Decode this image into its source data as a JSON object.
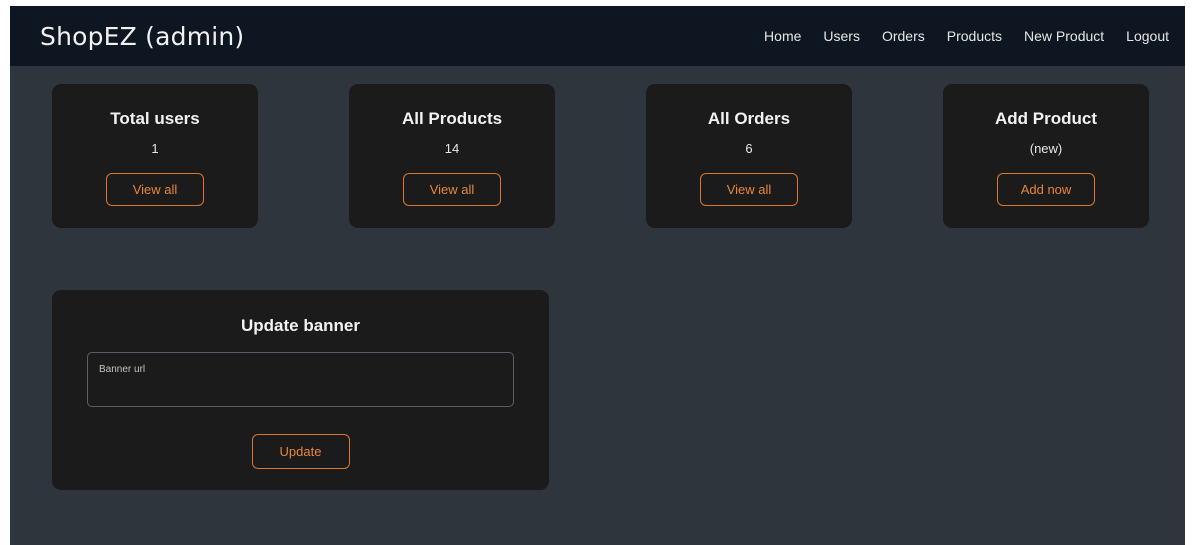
{
  "navbar": {
    "brand": "ShopEZ (admin)",
    "links": [
      "Home",
      "Users",
      "Orders",
      "Products",
      "New Product",
      "Logout"
    ]
  },
  "cards": [
    {
      "title": "Total users",
      "value": "1",
      "button": "View all"
    },
    {
      "title": "All Products",
      "value": "14",
      "button": "View all"
    },
    {
      "title": "All Orders",
      "value": "6",
      "button": "View all"
    },
    {
      "title": "Add Product",
      "value": "(new)",
      "button": "Add now"
    }
  ],
  "banner": {
    "title": "Update banner",
    "input_label": "Banner url",
    "input_value": "",
    "button": "Update"
  },
  "colors": {
    "background": "#2e353d",
    "navbar": "#0e1621",
    "card": "#1b1b1b",
    "accent": "#e8873a"
  }
}
